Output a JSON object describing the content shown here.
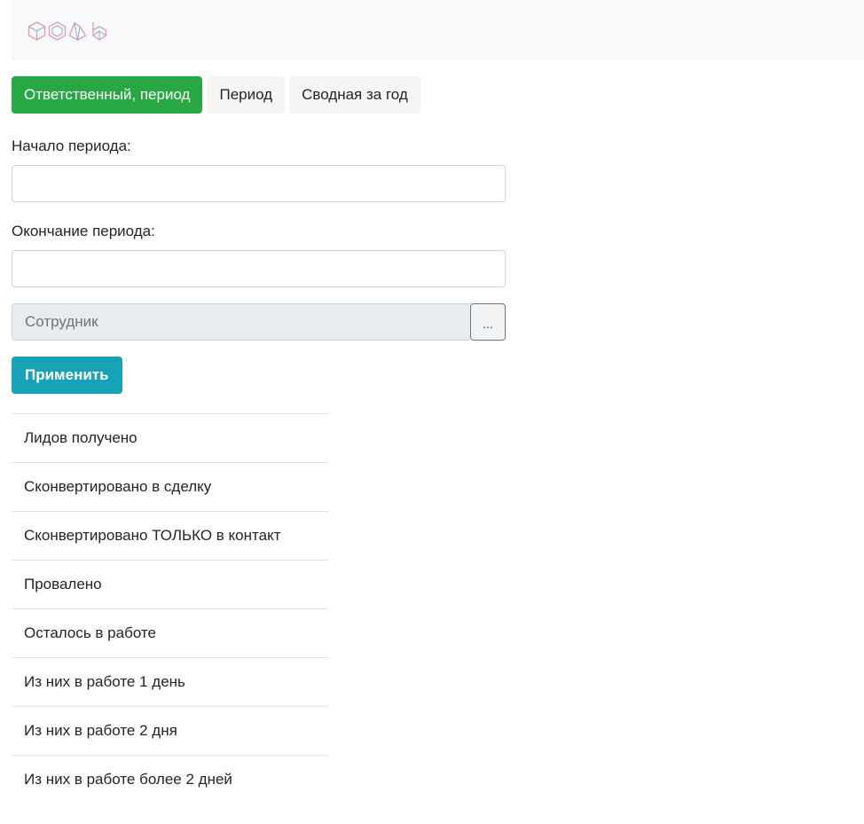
{
  "tabs": [
    {
      "label": "Ответственный, период",
      "active": true
    },
    {
      "label": "Период",
      "active": false
    },
    {
      "label": "Сводная за год",
      "active": false
    }
  ],
  "form": {
    "start_label": "Начало периода:",
    "start_value": "",
    "end_label": "Окончание периода:",
    "end_value": "",
    "employee_placeholder": "Сотрудник",
    "pick_label": "...",
    "apply_label": "Применить"
  },
  "stats": [
    "Лидов получено",
    "Сконвертировано в сделку",
    "Сконвертировано ТОЛЬКО в контакт",
    "Провалено",
    "Осталось в работе",
    "Из них в работе 1 день",
    "Из них в работе 2 дня",
    "Из них в работе более 2 дней"
  ],
  "colors": {
    "active_tab": "#28a745",
    "apply_button": "#17a2b8",
    "header_bg": "#f8f9fa"
  },
  "icons": [
    "cube-logo-icon",
    "cube-logo-icon",
    "cube-logo-icon",
    "cube-logo-icon"
  ]
}
